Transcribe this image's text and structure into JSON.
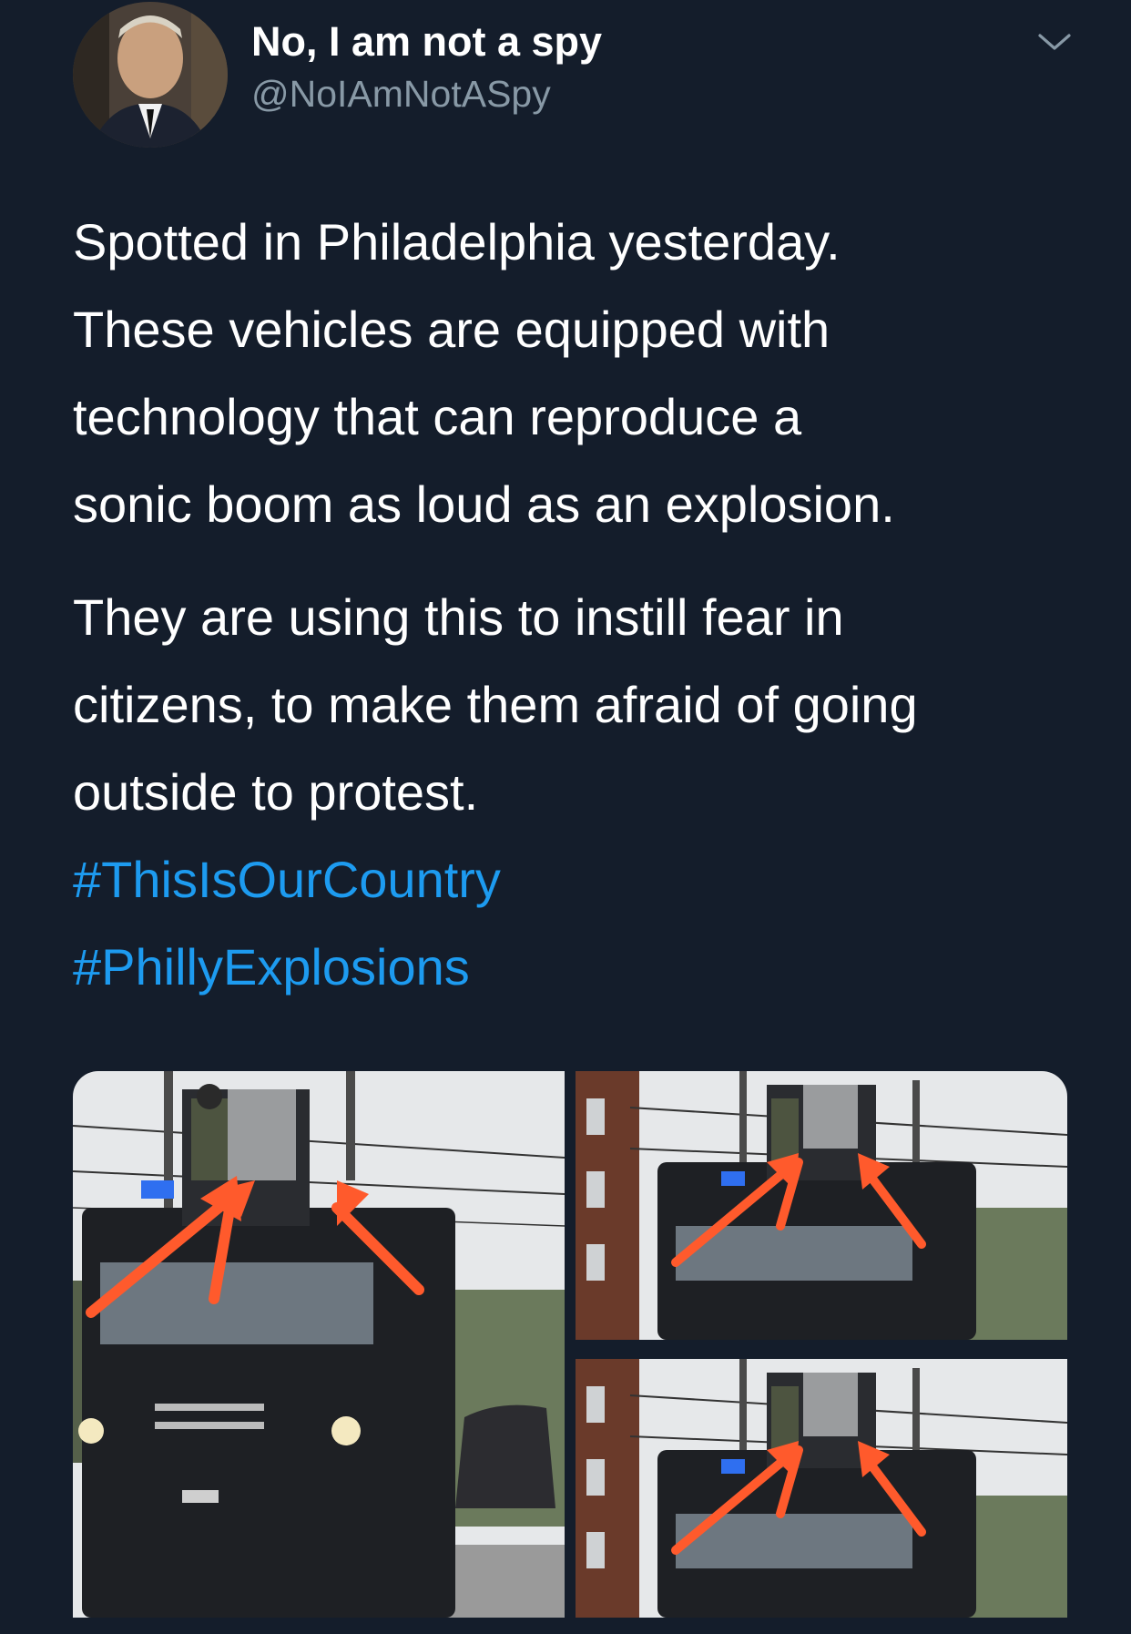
{
  "tweet": {
    "author": {
      "display_name": "No, I am not a spy",
      "handle": "@NoIAmNotASpy",
      "avatar_icon": "profile-photo-icon"
    },
    "menu_icon": "chevron-down-icon",
    "paragraphs": [
      {
        "lines": [
          "Spotted in Philadelphia yesterday.",
          "These vehicles are equipped with",
          "technology that can reproduce a",
          "sonic boom as loud as an explosion."
        ]
      },
      {
        "lines": [
          "They are using this to instill fear in",
          "citizens, to make them afraid of going",
          "outside to protest."
        ]
      }
    ],
    "hashtags": [
      "#ThisIsOurCountry",
      "#PhillyExplosions"
    ],
    "media": [
      {
        "name": "armored-vehicle-photo-main"
      },
      {
        "name": "armored-vehicle-photo-top-right"
      },
      {
        "name": "armored-vehicle-photo-bottom-right"
      }
    ],
    "colors": {
      "background": "#141d2b",
      "text": "#ffffff",
      "handle": "#8899a6",
      "hashtag": "#1d9bf0",
      "annotation_arrow": "#ff5a2c"
    }
  }
}
